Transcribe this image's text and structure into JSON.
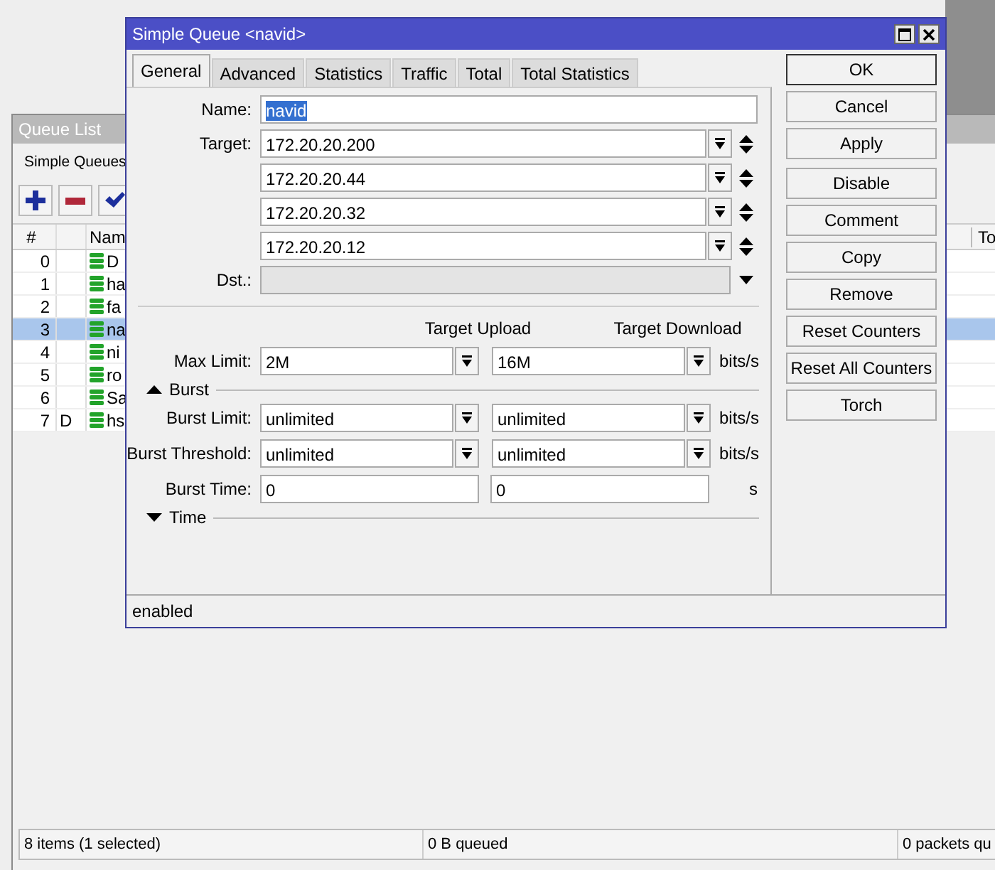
{
  "queue_list": {
    "title": "Queue List",
    "tab": "Simple Queues",
    "toolbar": [
      {
        "kind": "add"
      },
      {
        "kind": "remove"
      },
      {
        "kind": "enable"
      }
    ],
    "columns": [
      "#",
      "Nam",
      "To"
    ],
    "rows": [
      {
        "number": "0",
        "name": "D",
        "selected": false
      },
      {
        "number": "1",
        "name": "ha",
        "selected": false
      },
      {
        "number": "2",
        "name": "fa",
        "selected": false
      },
      {
        "number": "3",
        "name": "na",
        "selected": true
      },
      {
        "number": "4",
        "name": "ni",
        "selected": false
      },
      {
        "number": "5",
        "name": "ro",
        "selected": false
      },
      {
        "number": "6",
        "name": "Sa",
        "selected": false
      },
      {
        "number": "7",
        "flag": "D",
        "name": "hs",
        "selected": false
      }
    ],
    "status_bar": [
      "8 items (1 selected)",
      "0 B queued",
      "0 packets qu"
    ]
  },
  "dialog": {
    "title": "Simple Queue <navid>",
    "tabs": [
      {
        "label": "General",
        "selected": true
      },
      {
        "label": "Advanced",
        "selected": false
      },
      {
        "label": "Statistics",
        "selected": false
      },
      {
        "label": "Traffic",
        "selected": false
      },
      {
        "label": "Total",
        "selected": false
      },
      {
        "label": "Total Statistics",
        "selected": false
      }
    ],
    "name": {
      "label": "Name:",
      "value": "navid",
      "highlighted": true
    },
    "target": {
      "label": "Target:",
      "values": [
        "172.20.20.200",
        "172.20.20.44",
        "172.20.20.32",
        "172.20.20.12"
      ]
    },
    "dst": {
      "label": "Dst.:",
      "disabled": true
    },
    "columns": [
      "Target Upload",
      "Target Download"
    ],
    "max_limit": {
      "label": "Max Limit:",
      "upload": "2M",
      "download": "16M",
      "unit": "bits/s",
      "kind": "dropdown"
    },
    "sections": [
      {
        "label": "Burst",
        "expanded": true,
        "rows": [
          {
            "label": "Burst Limit:",
            "upload": "unlimited",
            "download": "unlimited",
            "unit": "bits/s",
            "kind": "dropdown"
          },
          {
            "label": "Burst Threshold:",
            "upload": "unlimited",
            "download": "unlimited",
            "unit": "bits/s",
            "kind": "dropdown"
          },
          {
            "label": "Burst Time:",
            "upload": "0",
            "download": "0",
            "unit": "s",
            "kind": "text"
          }
        ]
      },
      {
        "label": "Time",
        "expanded": false
      }
    ],
    "button_groups": [
      [
        {
          "label": "OK",
          "default": true
        },
        {
          "label": "Cancel",
          "default": false
        },
        {
          "label": "Apply",
          "default": false
        }
      ],
      [
        {
          "label": "Disable",
          "default": false
        },
        {
          "label": "Comment",
          "default": false
        },
        {
          "label": "Copy",
          "default": false
        },
        {
          "label": "Remove",
          "default": false
        },
        {
          "label": "Reset Counters",
          "default": false
        },
        {
          "label": "Reset All Counters",
          "default": false
        },
        {
          "label": "Torch",
          "default": false
        }
      ]
    ],
    "status": "enabled"
  }
}
